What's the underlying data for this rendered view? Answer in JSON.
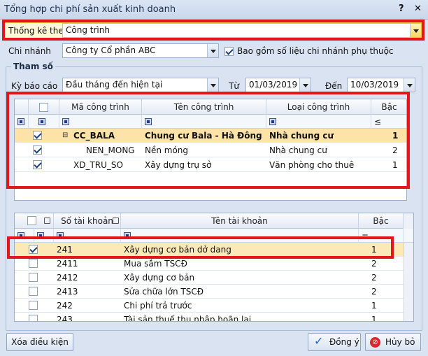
{
  "window": {
    "title": "Tổng hợp chi phí sản xuất kinh doanh",
    "help": "?",
    "close": "✕"
  },
  "form": {
    "thong_ke_label": "Thống kê theo",
    "thong_ke_value": "Công trình",
    "chi_nhanh_label": "Chi nhánh",
    "chi_nhanh_value": "Công ty Cổ phần ABC",
    "include_branch_label": "Bao gồm số liệu chi nhánh phụ thuộc",
    "params_title": "Tham số",
    "ky_bao_cao_label": "Kỳ báo cáo",
    "ky_bao_cao_value": "Đầu tháng đến hiện tại",
    "tu_label": "Từ",
    "tu_value": "01/03/2019",
    "den_label": "Đến",
    "den_value": "10/03/2019"
  },
  "grid1": {
    "headers": [
      "Mã công trình",
      "Tên công trình",
      "Loại công trình",
      "Bậc"
    ],
    "filter_bac": "≤",
    "rows": [
      {
        "code": "CC_BALA",
        "name": "Chung cư Bala - Hà Đông",
        "type": "Nhà chung cư",
        "level": "1"
      },
      {
        "code": "NEN_MONG",
        "name": "Nền móng",
        "type": "Nhà chung cư",
        "level": "2"
      },
      {
        "code": "XD_TRU_SO",
        "name": "Xây dựng trụ sở",
        "type": "Văn phòng cho thuê",
        "level": "1"
      }
    ]
  },
  "grid2": {
    "headers": [
      "Số tài khoản",
      "Tên tài khoản",
      "Bậc"
    ],
    "filter_bac": "=",
    "rows": [
      {
        "code": "241",
        "name": "Xây dựng cơ bản dở dang",
        "level": "1"
      },
      {
        "code": "2411",
        "name": "Mua sắm TSCĐ",
        "level": "2"
      },
      {
        "code": "2412",
        "name": "Xây dựng cơ bản",
        "level": "2"
      },
      {
        "code": "2413",
        "name": "Sửa chữa lớn TSCĐ",
        "level": "2"
      },
      {
        "code": "242",
        "name": "Chi phí trả trước",
        "level": "1"
      },
      {
        "code": "243",
        "name": "Tài sản thuế thu nhập hoãn lại",
        "level": "1"
      }
    ]
  },
  "buttons": {
    "clear": "Xóa điều kiện",
    "ok": "Đồng ý",
    "cancel": "Hủy bỏ"
  }
}
